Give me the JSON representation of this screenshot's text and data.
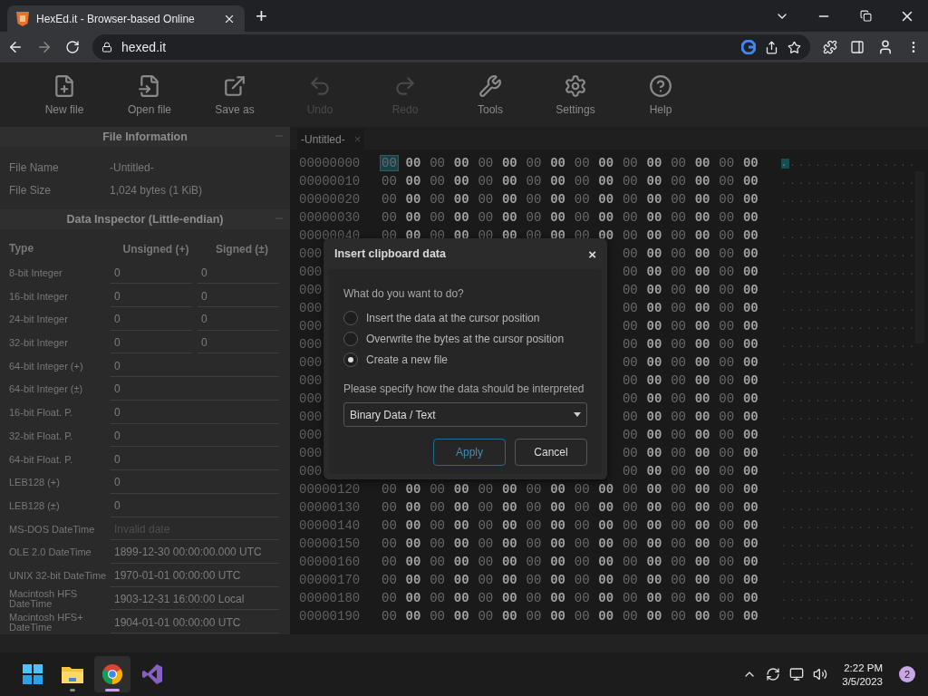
{
  "browser": {
    "tab_title": "HexEd.it - Browser-based Online",
    "new_tab": "+",
    "url": "hexed.it"
  },
  "toolbar": [
    {
      "kind": "new",
      "label": "New file",
      "disabled": false
    },
    {
      "kind": "open",
      "label": "Open file",
      "disabled": false
    },
    {
      "kind": "save",
      "label": "Save as",
      "disabled": false
    },
    {
      "kind": "undo",
      "label": "Undo",
      "disabled": true
    },
    {
      "kind": "redo",
      "label": "Redo",
      "disabled": true
    },
    {
      "kind": "tools",
      "label": "Tools",
      "disabled": false
    },
    {
      "kind": "settings",
      "label": "Settings",
      "disabled": false
    },
    {
      "kind": "help",
      "label": "Help",
      "disabled": false
    }
  ],
  "file_information": {
    "title": "File Information",
    "fields": [
      {
        "label": "File Name",
        "value": "-Untitled-"
      },
      {
        "label": "File Size",
        "value": "1,024 bytes (1 KiB)"
      }
    ]
  },
  "data_inspector": {
    "title": "Data Inspector (Little-endian)",
    "columns": [
      "Type",
      "Unsigned (+)",
      "Signed (±)"
    ],
    "rows": [
      {
        "type": "8-bit Integer",
        "values": [
          "0",
          "0"
        ],
        "muted": false
      },
      {
        "type": "16-bit Integer",
        "values": [
          "0",
          "0"
        ],
        "muted": false
      },
      {
        "type": "24-bit Integer",
        "values": [
          "0",
          "0"
        ],
        "muted": false
      },
      {
        "type": "32-bit Integer",
        "values": [
          "0",
          "0"
        ],
        "muted": false
      },
      {
        "type": "64-bit Integer (+)",
        "values": [
          "0"
        ],
        "muted": false
      },
      {
        "type": "64-bit Integer (±)",
        "values": [
          "0"
        ],
        "muted": false
      },
      {
        "type": "16-bit Float. P.",
        "values": [
          "0"
        ],
        "muted": false
      },
      {
        "type": "32-bit Float. P.",
        "values": [
          "0"
        ],
        "muted": false
      },
      {
        "type": "64-bit Float. P.",
        "values": [
          "0"
        ],
        "muted": false
      },
      {
        "type": "LEB128 (+)",
        "values": [
          "0"
        ],
        "muted": false
      },
      {
        "type": "LEB128 (±)",
        "values": [
          "0"
        ],
        "muted": false
      },
      {
        "type": "MS-DOS DateTime",
        "values": [
          "Invalid date"
        ],
        "muted": true
      },
      {
        "type": "OLE 2.0 DateTime",
        "values": [
          "1899-12-30 00:00:00.000 UTC"
        ],
        "muted": false
      },
      {
        "type": "UNIX 32-bit DateTime",
        "values": [
          "1970-01-01 00:00:00 UTC"
        ],
        "muted": false
      },
      {
        "type": "Macintosh HFS DateTime",
        "values": [
          "1903-12-31 16:00:00 Local"
        ],
        "muted": false
      },
      {
        "type": "Macintosh HFS+ DateTime",
        "values": [
          "1904-01-01 00:00:00 UTC"
        ],
        "muted": false
      }
    ]
  },
  "editor": {
    "tab": {
      "label": "-Untitled-",
      "close": "×",
      "selected": true
    },
    "rows": [
      {
        "address": "00000000",
        "bytes": [
          "00",
          "00",
          "00",
          "00",
          "00",
          "00",
          "00",
          "00",
          "00",
          "00",
          "00",
          "00",
          "00",
          "00",
          "00",
          "00"
        ],
        "ascii": "................",
        "cursor": true
      },
      {
        "address": "00000010",
        "bytes": [
          "00",
          "00",
          "00",
          "00",
          "00",
          "00",
          "00",
          "00",
          "00",
          "00",
          "00",
          "00",
          "00",
          "00",
          "00",
          "00"
        ],
        "ascii": "................",
        "cursor": false
      },
      {
        "address": "00000020",
        "bytes": [
          "00",
          "00",
          "00",
          "00",
          "00",
          "00",
          "00",
          "00",
          "00",
          "00",
          "00",
          "00",
          "00",
          "00",
          "00",
          "00"
        ],
        "ascii": "................",
        "cursor": false
      },
      {
        "address": "00000030",
        "bytes": [
          "00",
          "00",
          "00",
          "00",
          "00",
          "00",
          "00",
          "00",
          "00",
          "00",
          "00",
          "00",
          "00",
          "00",
          "00",
          "00"
        ],
        "ascii": "................",
        "cursor": false
      },
      {
        "address": "00000040",
        "bytes": [
          "00",
          "00",
          "00",
          "00",
          "00",
          "00",
          "00",
          "00",
          "00",
          "00",
          "00",
          "00",
          "00",
          "00",
          "00",
          "00"
        ],
        "ascii": "................",
        "cursor": false
      },
      {
        "address": "000",
        "bytes": [
          "00",
          "00",
          "00",
          "00",
          "00",
          "00"
        ],
        "ascii": "................",
        "cursor": false
      },
      {
        "address": "000",
        "bytes": [
          "00",
          "00",
          "00",
          "00",
          "00",
          "00"
        ],
        "ascii": "................",
        "cursor": false
      },
      {
        "address": "000",
        "bytes": [
          "00",
          "00",
          "00",
          "00",
          "00",
          "00"
        ],
        "ascii": "................",
        "cursor": false
      },
      {
        "address": "000",
        "bytes": [
          "00",
          "00",
          "00",
          "00",
          "00",
          "00"
        ],
        "ascii": "................",
        "cursor": false
      },
      {
        "address": "000",
        "bytes": [
          "00",
          "00",
          "00",
          "00",
          "00",
          "00"
        ],
        "ascii": "................",
        "cursor": false
      },
      {
        "address": "000",
        "bytes": [
          "00",
          "00",
          "00",
          "00",
          "00",
          "00"
        ],
        "ascii": "................",
        "cursor": false
      },
      {
        "address": "000",
        "bytes": [
          "00",
          "00",
          "00",
          "00",
          "00",
          "00"
        ],
        "ascii": "................",
        "cursor": false
      },
      {
        "address": "000",
        "bytes": [
          "00",
          "00",
          "00",
          "00",
          "00",
          "00"
        ],
        "ascii": "................",
        "cursor": false
      },
      {
        "address": "000",
        "bytes": [
          "00",
          "00",
          "00",
          "00",
          "00",
          "00"
        ],
        "ascii": "................",
        "cursor": false
      },
      {
        "address": "000",
        "bytes": [
          "00",
          "00",
          "00",
          "00",
          "00",
          "00"
        ],
        "ascii": "................",
        "cursor": false
      },
      {
        "address": "000",
        "bytes": [
          "00",
          "00",
          "00",
          "00",
          "00",
          "00"
        ],
        "ascii": "................",
        "cursor": false
      },
      {
        "address": "000",
        "bytes": [
          "00",
          "00",
          "00",
          "00",
          "00",
          "00"
        ],
        "ascii": "................",
        "cursor": false
      },
      {
        "address": "000",
        "bytes": [
          "00",
          "00",
          "00",
          "00",
          "00",
          "00"
        ],
        "ascii": "................",
        "cursor": false
      },
      {
        "address": "00000120",
        "bytes": [
          "00",
          "00",
          "00",
          "00",
          "00",
          "00",
          "00",
          "00",
          "00",
          "00",
          "00",
          "00",
          "00",
          "00",
          "00",
          "00"
        ],
        "ascii": "................",
        "cursor": false
      },
      {
        "address": "00000130",
        "bytes": [
          "00",
          "00",
          "00",
          "00",
          "00",
          "00",
          "00",
          "00",
          "00",
          "00",
          "00",
          "00",
          "00",
          "00",
          "00",
          "00"
        ],
        "ascii": "................",
        "cursor": false
      },
      {
        "address": "00000140",
        "bytes": [
          "00",
          "00",
          "00",
          "00",
          "00",
          "00",
          "00",
          "00",
          "00",
          "00",
          "00",
          "00",
          "00",
          "00",
          "00",
          "00"
        ],
        "ascii": "................",
        "cursor": false
      },
      {
        "address": "00000150",
        "bytes": [
          "00",
          "00",
          "00",
          "00",
          "00",
          "00",
          "00",
          "00",
          "00",
          "00",
          "00",
          "00",
          "00",
          "00",
          "00",
          "00"
        ],
        "ascii": "................",
        "cursor": false
      },
      {
        "address": "00000160",
        "bytes": [
          "00",
          "00",
          "00",
          "00",
          "00",
          "00",
          "00",
          "00",
          "00",
          "00",
          "00",
          "00",
          "00",
          "00",
          "00",
          "00"
        ],
        "ascii": "................",
        "cursor": false
      },
      {
        "address": "00000170",
        "bytes": [
          "00",
          "00",
          "00",
          "00",
          "00",
          "00",
          "00",
          "00",
          "00",
          "00",
          "00",
          "00",
          "00",
          "00",
          "00",
          "00"
        ],
        "ascii": "................",
        "cursor": false
      },
      {
        "address": "00000180",
        "bytes": [
          "00",
          "00",
          "00",
          "00",
          "00",
          "00",
          "00",
          "00",
          "00",
          "00",
          "00",
          "00",
          "00",
          "00",
          "00",
          "00"
        ],
        "ascii": "................",
        "cursor": false
      },
      {
        "address": "00000190",
        "bytes": [
          "00",
          "00",
          "00",
          "00",
          "00",
          "00",
          "00",
          "00",
          "00",
          "00",
          "00",
          "00",
          "00",
          "00",
          "00",
          "00"
        ],
        "ascii": "................",
        "cursor": false
      }
    ]
  },
  "dialog": {
    "title": "Insert clipboard data",
    "close": "×",
    "question": "What do you want to do?",
    "choices": [
      {
        "label": "Insert the data at the cursor position",
        "selected": false
      },
      {
        "label": "Overwrite the bytes at the cursor position",
        "selected": false
      },
      {
        "label": "Create a new file",
        "selected": true
      }
    ],
    "select_label": "Please specify how the data should be interpreted",
    "select_value": "Binary Data / Text",
    "buttons": [
      {
        "label": "Apply",
        "kind": "primary"
      },
      {
        "label": "Cancel",
        "kind": "secondary"
      }
    ]
  },
  "taskbar": {
    "apps": [
      {
        "kind": "start",
        "running": false,
        "active": false
      },
      {
        "kind": "folder",
        "running": true,
        "active": false
      },
      {
        "kind": "chrome",
        "running": true,
        "active": true
      },
      {
        "kind": "studio",
        "running": false,
        "active": false
      }
    ],
    "time": "2:22 PM",
    "date": "3/5/2023",
    "badge": "2"
  }
}
